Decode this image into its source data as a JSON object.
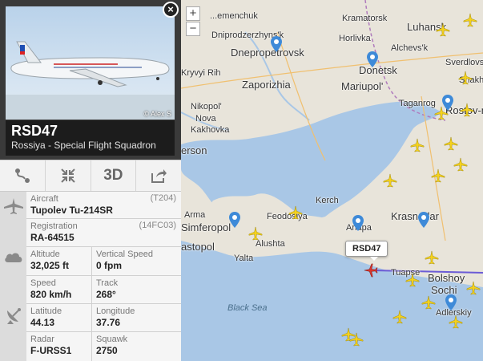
{
  "map": {
    "sea_label": "Black Sea",
    "zoom_in": "+",
    "zoom_out": "−",
    "selected_flight_label": "RSD47",
    "cities": {
      "zhemenchuk": "...emenchuk",
      "dnipro": "Dniprodzerzhyns'k",
      "dnepropetrovsk": "Dnepropetrovsk",
      "kramatorsk": "Kramatorsk",
      "horlivka": "Horlivka",
      "luhansk": "Luhansk",
      "alchevsk": "Alchevs'k",
      "svredlovsk": "Sverdlovs'k",
      "kryvyi": "Kryvyi Rih",
      "zaporizhia": "Zaporizhia",
      "donetsk": "Donetsk",
      "shakhty": "Shakhty",
      "mariupol": "Mariupol'",
      "taganrog": "Taganrog",
      "rostov": "Rostov-n",
      "nikopol": "Nikopol'",
      "kakhovka": "Nova\nKakhovka",
      "kherson": "erson",
      "kerch": "Kerch",
      "krasnodar": "Krasnodar",
      "simferopol": "Simferopol",
      "feodosiya": "Feodosiya",
      "anapa": "Anapa",
      "alushta": "Alushta",
      "sevastopol": "astopol",
      "yalta": "Yalta",
      "tuapse": "Tuapse",
      "bolshoy": "Bolshoy",
      "sochi": "Sochi",
      "adlerskiy": "Adlerskiy",
      "armavir": "Arma"
    }
  },
  "panel": {
    "photo_credit": "© Alex S",
    "close": "×",
    "callsign": "RSD47",
    "airline": "Rossiya - Special Flight Squadron",
    "toolbar": {
      "three_d": "3D"
    },
    "aircraft": {
      "label": "Aircraft",
      "code": "(T204)",
      "value": "Tupolev Tu-214SR"
    },
    "registration": {
      "label": "Registration",
      "code": "(14FC03)",
      "value": "RA-64515"
    },
    "altitude": {
      "label": "Altitude",
      "value": "32,025 ft"
    },
    "vertical_speed": {
      "label": "Vertical Speed",
      "value": "0 fpm"
    },
    "speed": {
      "label": "Speed",
      "value": "820 km/h"
    },
    "track": {
      "label": "Track",
      "value": "268°"
    },
    "latitude": {
      "label": "Latitude",
      "value": "44.13"
    },
    "longitude": {
      "label": "Longitude",
      "value": "37.76"
    },
    "radar": {
      "label": "Radar",
      "value": "F-URSS1"
    },
    "squawk": {
      "label": "Squawk",
      "value": "2750"
    }
  },
  "colors": {
    "sea": "#a9c7e6",
    "land": "#e8e4da",
    "plane": "#f5d21c",
    "selected_plane": "#d9342b",
    "route": "#6b5bd6"
  }
}
